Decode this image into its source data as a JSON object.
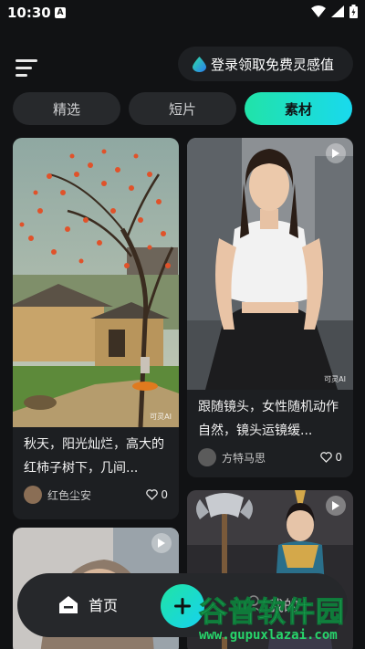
{
  "status": {
    "time": "10:30",
    "notif_letter": "A"
  },
  "header": {
    "login_text": "登录领取免费灵感值"
  },
  "tabs": [
    {
      "label": "精选",
      "active": false
    },
    {
      "label": "短片",
      "active": false
    },
    {
      "label": "素材",
      "active": true
    }
  ],
  "feed": [
    {
      "title": "秋天，阳光灿烂，高大的红柿子树下，几间...",
      "author": "红色尘安",
      "likes": "0",
      "has_play": false,
      "ai_tag": "可灵AI"
    },
    {
      "title": "跟随镜头，女性随机动作自然，镜头运镜缓...",
      "author": "方特马思",
      "likes": "0",
      "has_play": true,
      "ai_tag": "可灵AI"
    },
    {
      "title": "",
      "author": "",
      "likes": "",
      "has_play": true
    },
    {
      "title": "",
      "author": "",
      "likes": "",
      "has_play": true
    }
  ],
  "bottom_nav": {
    "home_label": "首页",
    "mine_label": "我的"
  },
  "watermark": {
    "main": "谷普软件园",
    "url": "www.gupuxlazai.com"
  },
  "colors": {
    "accent_start": "#21e3a8",
    "accent_end": "#19d9ee",
    "background": "#111214"
  }
}
